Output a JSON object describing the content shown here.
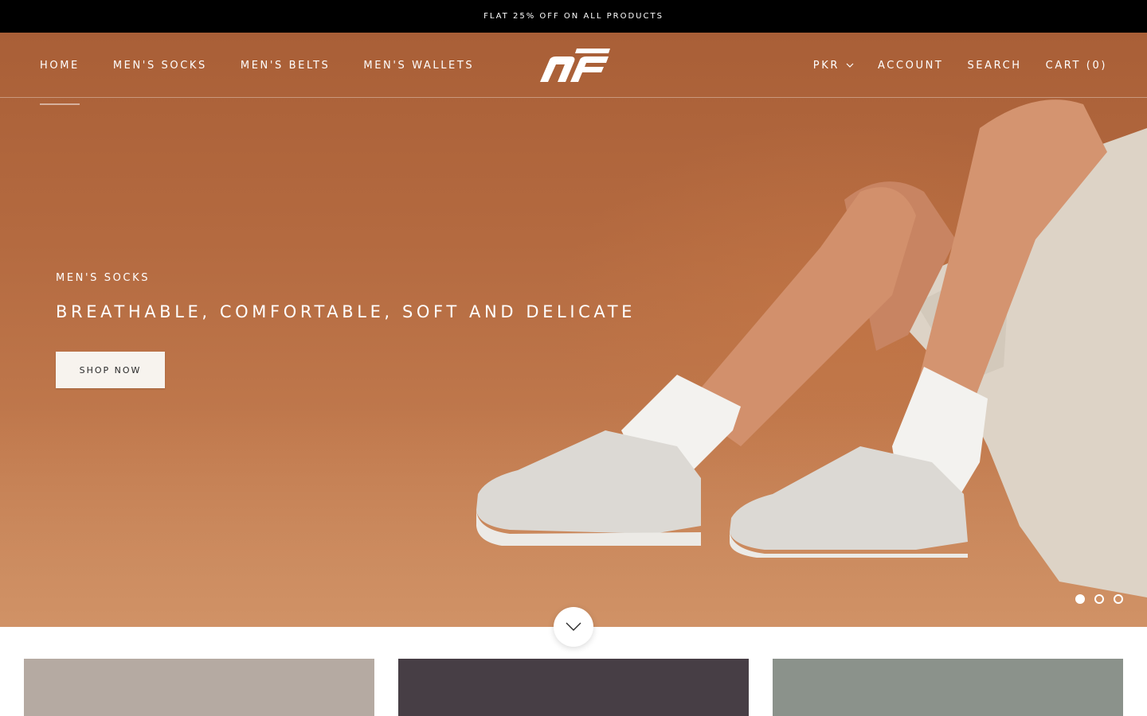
{
  "announcement": {
    "text": "FLAT 25% OFF ON ALL PRODUCTS"
  },
  "header": {
    "nav_left": [
      {
        "label": "HOME",
        "active": true
      },
      {
        "label": "MEN'S SOCKS"
      },
      {
        "label": "MEN'S BELTS"
      },
      {
        "label": "MEN'S WALLETS"
      }
    ],
    "logo_icon": "brand-logo",
    "currency": {
      "label": "PKR",
      "icon": "chevron-down-icon"
    },
    "account_label": "ACCOUNT",
    "search_label": "SEARCH",
    "cart_label": "CART (0)"
  },
  "hero": {
    "subheading": "MEN'S SOCKS",
    "heading": "BREATHABLE, COMFORTABLE, SOFT AND DELICATE",
    "button_label": "SHOP NOW",
    "slide_count": 3,
    "active_slide": 1,
    "scroll_icon": "chevron-down-icon"
  },
  "colors": {
    "announcement_bg": "#000000",
    "hero_bg": "#b46a40",
    "collection_1": "#b5aaa2",
    "collection_2": "#473e45",
    "collection_3": "#8b928b"
  },
  "collections": [
    {
      "color": "#b5aaa2"
    },
    {
      "color": "#473e45"
    },
    {
      "color": "#8b928b"
    }
  ]
}
